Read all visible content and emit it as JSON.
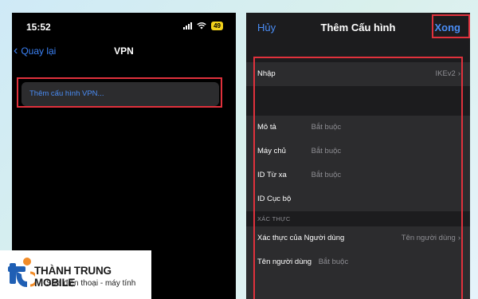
{
  "left_screen": {
    "status_time": "15:52",
    "battery": "49",
    "nav": {
      "back_label": "Quay lại",
      "title": "VPN"
    },
    "add_vpn_label": "Thêm cấu hình VPN..."
  },
  "right_screen": {
    "header": {
      "cancel_label": "Hủy",
      "title": "Thêm Cấu hình",
      "done_label": "Xong"
    },
    "type_row": {
      "label": "Nhập",
      "value": "IKEv2"
    },
    "fields": [
      {
        "label": "Mô tả",
        "placeholder": "Bắt buộc"
      },
      {
        "label": "Máy chủ",
        "placeholder": "Bắt buộc"
      },
      {
        "label": "ID Từ xa",
        "placeholder": "Bắt buộc"
      },
      {
        "label": "ID Cục bộ",
        "placeholder": ""
      }
    ],
    "auth_section_header": "XÁC THỰC",
    "auth_row": {
      "label": "Xác thực của Người dùng",
      "value": "Tên người dùng"
    },
    "username_row": {
      "label": "Tên người dùng",
      "placeholder": "Bắt buộc"
    }
  },
  "brand": {
    "name": "THÀNH TRUNG MOBILE",
    "tagline": "Sửa điện thoại - máy tính",
    "accent_color": "#1f5fb4",
    "orange_color": "#f28c28"
  },
  "colors": {
    "highlight": "#e0313c",
    "ios_blue": "#4a8df6"
  }
}
